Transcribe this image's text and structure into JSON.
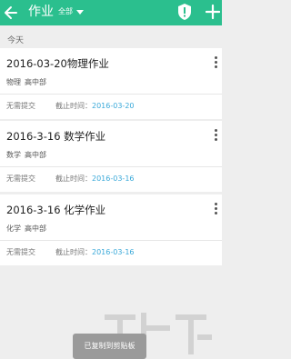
{
  "header": {
    "title": "作业",
    "filter_label": "全部"
  },
  "section": {
    "label": "今天"
  },
  "cards": [
    {
      "title": "2016-03-20物理作业",
      "subject": "物理",
      "school": "高中部",
      "status": "无需提交",
      "deadline_label": "截止时间：",
      "deadline_date": "2016-03-20"
    },
    {
      "title": "2016-3-16 数学作业",
      "subject": "数学",
      "school": "高中部",
      "status": "无需提交",
      "deadline_label": "截止时间：",
      "deadline_date": "2016-03-16"
    },
    {
      "title": "2016-3-16 化学作业",
      "subject": "化学",
      "school": "高中部",
      "status": "无需提交",
      "deadline_label": "截止时间：",
      "deadline_date": "2016-03-16"
    }
  ],
  "toast": {
    "text": "已复制到剪贴板"
  },
  "colors": {
    "header_bg": "#2bbf8e",
    "date_accent": "#3aa9d9"
  },
  "icons": {
    "back": "back-arrow-icon",
    "alert": "shield-alert-icon",
    "add": "plus-icon",
    "more": "more-vertical-icon"
  }
}
